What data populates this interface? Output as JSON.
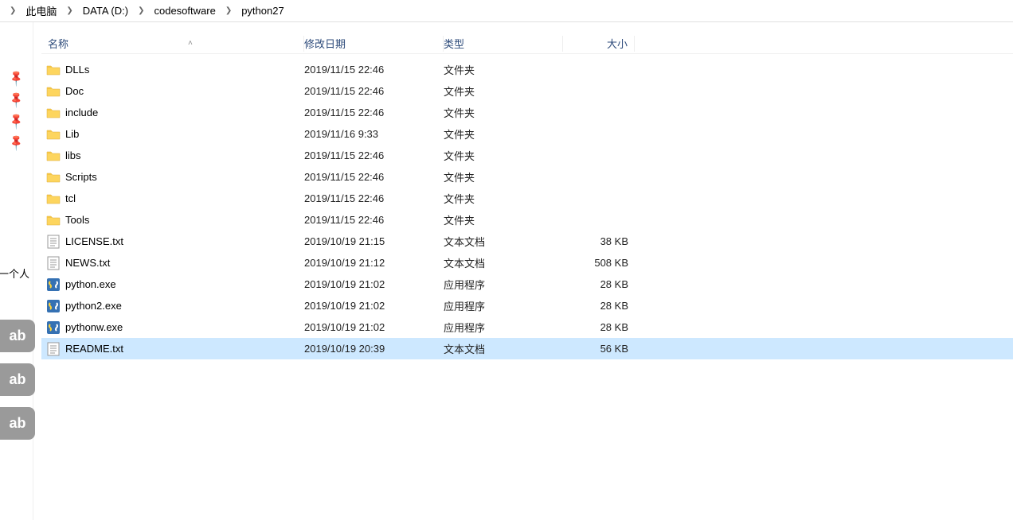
{
  "breadcrumb": {
    "items": [
      "此电脑",
      "DATA (D:)",
      "codesoftware",
      "python27"
    ]
  },
  "columns": {
    "name": "名称",
    "modified": "修改日期",
    "type": "类型",
    "size": "大小"
  },
  "left_rail": {
    "label": "一个人",
    "tabs": [
      "ab",
      "ab",
      "ab"
    ]
  },
  "files": [
    {
      "icon": "folder",
      "name": "DLLs",
      "modified": "2019/11/15 22:46",
      "type": "文件夹",
      "size": ""
    },
    {
      "icon": "folder",
      "name": "Doc",
      "modified": "2019/11/15 22:46",
      "type": "文件夹",
      "size": ""
    },
    {
      "icon": "folder",
      "name": "include",
      "modified": "2019/11/15 22:46",
      "type": "文件夹",
      "size": ""
    },
    {
      "icon": "folder",
      "name": "Lib",
      "modified": "2019/11/16 9:33",
      "type": "文件夹",
      "size": ""
    },
    {
      "icon": "folder",
      "name": "libs",
      "modified": "2019/11/15 22:46",
      "type": "文件夹",
      "size": ""
    },
    {
      "icon": "folder",
      "name": "Scripts",
      "modified": "2019/11/15 22:46",
      "type": "文件夹",
      "size": ""
    },
    {
      "icon": "folder",
      "name": "tcl",
      "modified": "2019/11/15 22:46",
      "type": "文件夹",
      "size": ""
    },
    {
      "icon": "folder",
      "name": "Tools",
      "modified": "2019/11/15 22:46",
      "type": "文件夹",
      "size": ""
    },
    {
      "icon": "txt",
      "name": "LICENSE.txt",
      "modified": "2019/10/19 21:15",
      "type": "文本文档",
      "size": "38 KB"
    },
    {
      "icon": "txt",
      "name": "NEWS.txt",
      "modified": "2019/10/19 21:12",
      "type": "文本文档",
      "size": "508 KB"
    },
    {
      "icon": "exe",
      "name": "python.exe",
      "modified": "2019/10/19 21:02",
      "type": "应用程序",
      "size": "28 KB"
    },
    {
      "icon": "exe",
      "name": "python2.exe",
      "modified": "2019/10/19 21:02",
      "type": "应用程序",
      "size": "28 KB"
    },
    {
      "icon": "exe",
      "name": "pythonw.exe",
      "modified": "2019/10/19 21:02",
      "type": "应用程序",
      "size": "28 KB"
    },
    {
      "icon": "txt",
      "name": "README.txt",
      "modified": "2019/10/19 20:39",
      "type": "文本文档",
      "size": "56 KB",
      "selected": true
    }
  ]
}
